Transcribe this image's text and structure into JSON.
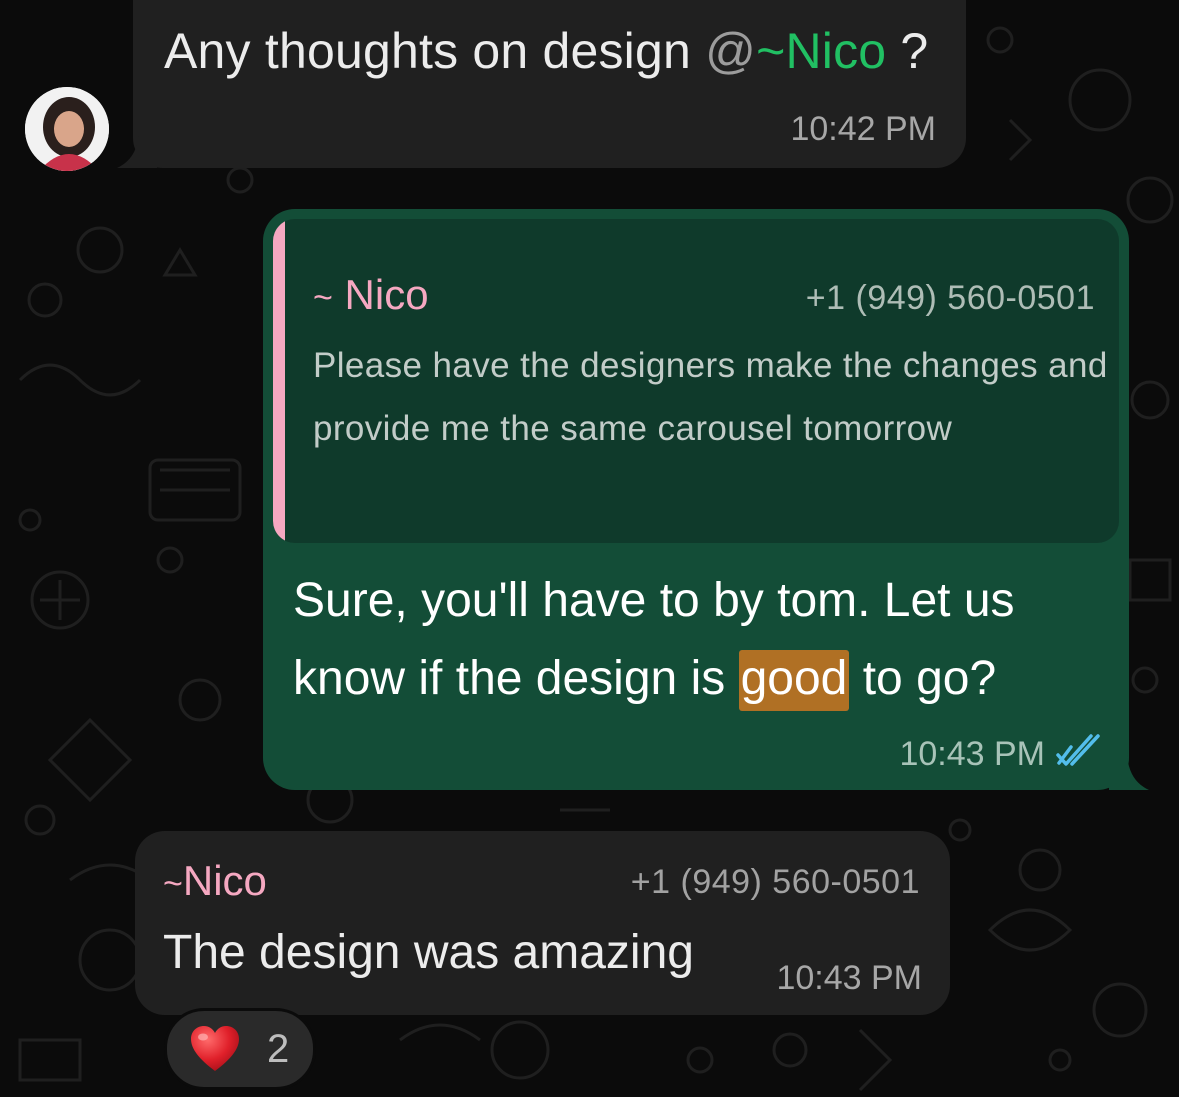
{
  "messages": {
    "first": {
      "text_before": "Any thoughts on design ",
      "mention_at": "@",
      "mention_name": "~Nico",
      "text_after": " ?",
      "time": "10:42 PM"
    },
    "reply": {
      "quote": {
        "author_tilde": "~",
        "author_name": "Nico",
        "phone": "+1 (949) 560-0501",
        "text": "Please have the designers make the changes and provide me the same carousel tomorrow"
      },
      "text_before": "Sure, you'll have to by tom. Let us know if the design is ",
      "highlight": "good",
      "text_after": " to go?",
      "time": "10:43 PM",
      "status_icon": "double-check-read-icon"
    },
    "last": {
      "author_tilde": "~",
      "author_name": "Nico",
      "phone": "+1 (949) 560-0501",
      "text": "The design was amazing",
      "time": "10:43 PM"
    }
  },
  "reaction": {
    "emoji_icon": "red-heart-icon",
    "count": "2"
  },
  "colors": {
    "background": "#0b0b0b",
    "incoming_bubble": "#202020",
    "outgoing_bubble": "#134d37",
    "quote_background": "#0f3a2b",
    "author_pink": "#f5a8c1",
    "mention_green": "#21c063",
    "highlight": "#b07024",
    "read_ticks": "#53bdeb"
  }
}
